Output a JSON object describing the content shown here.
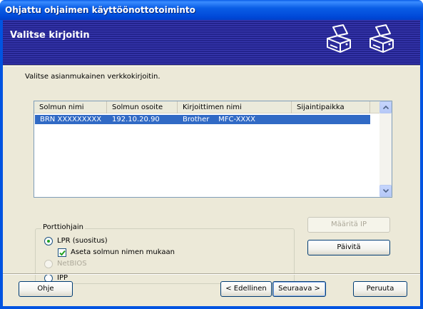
{
  "window": {
    "title": "Ohjattu ohjaimen käyttöönottotoiminto"
  },
  "banner": {
    "heading": "Valitse kirjoitin",
    "icons": [
      "printer-icon",
      "printer-icon"
    ]
  },
  "instruction": "Valitse asianmukainen verkkokirjoitin.",
  "table": {
    "columns": [
      "Solmun nimi",
      "Solmun osoite",
      "Kirjoittimen nimi",
      "Sijaintipaikka"
    ],
    "rows": [
      {
        "node_name": "BRN XXXXXXXXX",
        "node_address": "192.10.20.90",
        "printer_name": "Brother    MFC-XXXX",
        "location": "",
        "selected": true
      }
    ]
  },
  "port_driver": {
    "label": "Porttiohjain",
    "options": [
      {
        "label": "LPR (suositus)",
        "selected": true,
        "enabled": true
      },
      {
        "label": "NetBIOS",
        "selected": false,
        "enabled": false
      },
      {
        "label": "IPP",
        "selected": false,
        "enabled": true
      }
    ],
    "checkbox": {
      "label": "Aseta solmun nimen mukaan",
      "checked": true
    }
  },
  "buttons": {
    "set_ip": "Määritä IP",
    "refresh": "Päivitä",
    "help": "Ohje",
    "back": "< Edellinen",
    "next": "Seuraava >",
    "cancel": "Peruuta"
  },
  "colors": {
    "title_bar": "#0053e1",
    "banner": "#2a2aa0",
    "selection": "#316ac5",
    "dialog_face": "#ece9d8"
  }
}
